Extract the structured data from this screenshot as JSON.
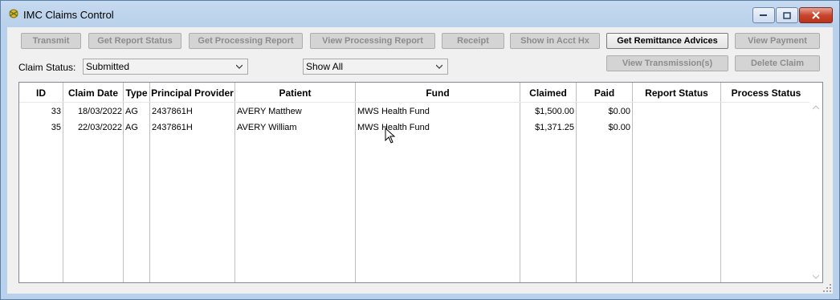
{
  "window": {
    "title": "IMC Claims Control"
  },
  "toolbar": {
    "transmit": "Transmit",
    "get_report_status": "Get Report Status",
    "get_processing_report": "Get Processing Report",
    "view_processing_report": "View Processing Report",
    "receipt": "Receipt",
    "show_in_acct_hx": "Show in Acct Hx",
    "get_remittance_advices": "Get Remittance Advices",
    "view_payment": "View Payment",
    "view_transmissions": "View Transmission(s)",
    "delete_claim": "Delete Claim"
  },
  "filters": {
    "claim_status_label": "Claim Status:",
    "claim_status_value": "Submitted",
    "show_value": "Show All"
  },
  "table": {
    "columns": [
      "ID",
      "Claim Date",
      "Type",
      "Principal Provider",
      "Patient",
      "Fund",
      "Claimed",
      "Paid",
      "Report Status",
      "Process Status"
    ],
    "rows": [
      {
        "id": "33",
        "date": "18/03/2022",
        "type": "AG",
        "provider": "2437861H",
        "patient": "AVERY Matthew",
        "fund": "MWS Health Fund",
        "claimed": "$1,500.00",
        "paid": "$0.00",
        "report_status": "",
        "process_status": ""
      },
      {
        "id": "35",
        "date": "22/03/2022",
        "type": "AG",
        "provider": "2437861H",
        "patient": "AVERY William",
        "fund": "MWS Health Fund",
        "claimed": "$1,371.25",
        "paid": "$0.00",
        "report_status": "",
        "process_status": ""
      }
    ]
  }
}
